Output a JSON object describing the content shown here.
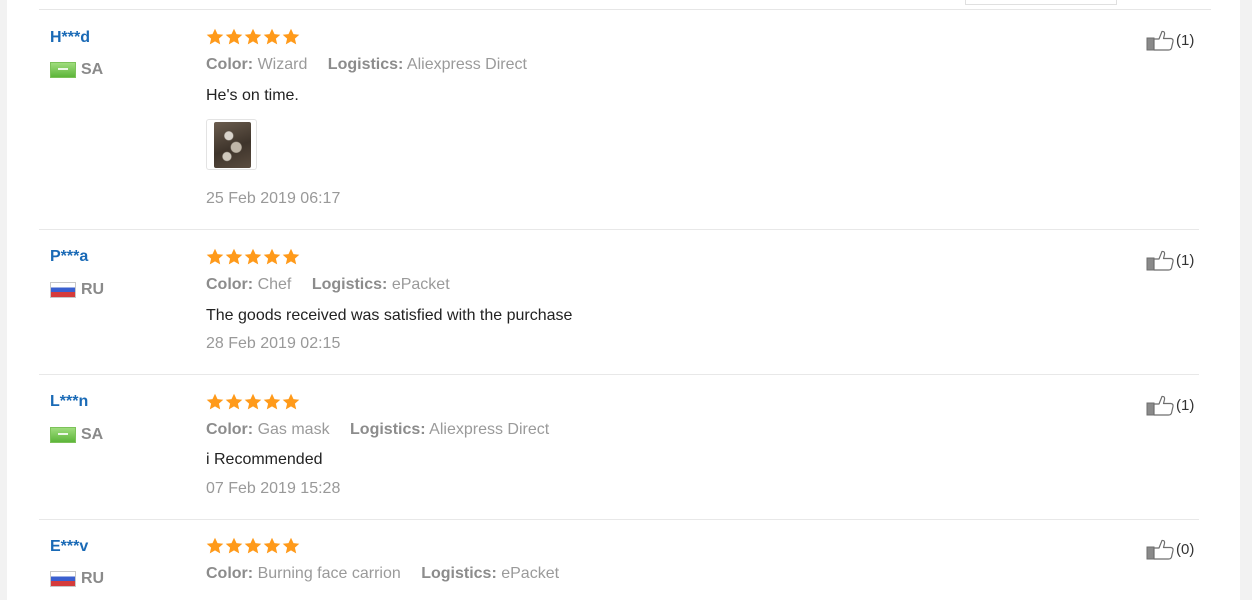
{
  "reviews": [
    {
      "user": "H***d",
      "country": "SA",
      "flag": "sa",
      "rating": 5,
      "color_label": "Color:",
      "color_value": "Wizard",
      "logistics_label": "Logistics:",
      "logistics_value": "Aliexpress Direct",
      "comment": "He's on time.",
      "has_photo": true,
      "date": "25 Feb 2019 06:17",
      "helpful": "(1)"
    },
    {
      "user": "P***a",
      "country": "RU",
      "flag": "ru",
      "rating": 5,
      "color_label": "Color:",
      "color_value": "Chef",
      "logistics_label": "Logistics:",
      "logistics_value": "ePacket",
      "comment": "The goods received was satisfied with the purchase",
      "has_photo": false,
      "date": "28 Feb 2019 02:15",
      "helpful": "(1)"
    },
    {
      "user": "L***n",
      "country": "SA",
      "flag": "sa",
      "rating": 5,
      "color_label": "Color:",
      "color_value": "Gas mask",
      "logistics_label": "Logistics:",
      "logistics_value": "Aliexpress Direct",
      "comment": "i Recommended",
      "has_photo": false,
      "date": "07 Feb 2019 15:28",
      "helpful": "(1)"
    },
    {
      "user": "E***v",
      "country": "RU",
      "flag": "ru",
      "rating": 5,
      "color_label": "Color:",
      "color_value": "Burning face carrion",
      "logistics_label": "Logistics:",
      "logistics_value": "ePacket",
      "comment": "",
      "has_photo": false,
      "date": "",
      "helpful": "(0)"
    }
  ],
  "colors": {
    "star": "#ff9a1a",
    "username": "#1a6ab6",
    "muted": "#999999"
  },
  "icons": {
    "star": "star-icon",
    "helpful": "thumbs-up-icon"
  }
}
